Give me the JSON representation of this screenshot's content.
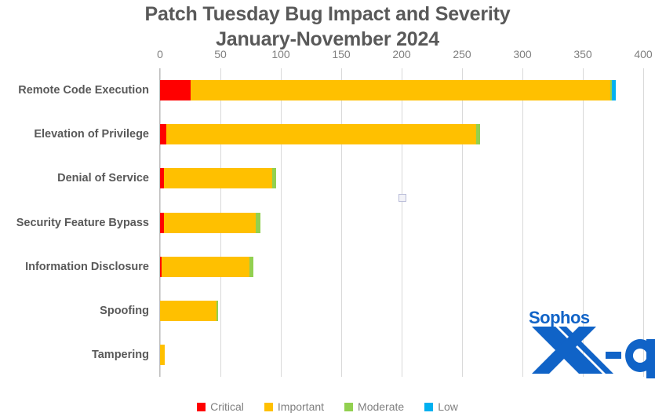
{
  "chart_data": {
    "type": "bar",
    "orientation": "horizontal",
    "stacked": true,
    "title": "Patch Tuesday Bug Impact and Severity",
    "subtitle": "January-November 2024",
    "xlabel": "",
    "ylabel": "",
    "xlim": [
      0,
      400
    ],
    "xticks": [
      0,
      50,
      100,
      150,
      200,
      250,
      300,
      350,
      400
    ],
    "grid": "vertical",
    "legend_position": "bottom",
    "categories": [
      "Remote Code Execution",
      "Elevation of Privilege",
      "Denial of Service",
      "Security Feature Bypass",
      "Information Disclosure",
      "Spoofing",
      "Tampering"
    ],
    "series": [
      {
        "name": "Critical",
        "color": "#FF0000",
        "values": [
          25,
          5,
          3,
          3,
          1,
          0,
          0
        ]
      },
      {
        "name": "Important",
        "color": "#FFC000",
        "values": [
          348,
          257,
          90,
          76,
          73,
          47,
          4
        ]
      },
      {
        "name": "Moderate",
        "color": "#92D050",
        "values": [
          1,
          3,
          3,
          4,
          3,
          1,
          0
        ]
      },
      {
        "name": "Low",
        "color": "#00B0F0",
        "values": [
          3,
          0,
          0,
          0,
          0,
          0,
          0
        ]
      }
    ],
    "totals": [
      377,
      265,
      96,
      83,
      77,
      48,
      4
    ]
  },
  "chart": {
    "title_line_1": "Patch Tuesday Bug Impact and Severity",
    "title_line_2": "January-November 2024",
    "xticks": [
      "0",
      "50",
      "100",
      "150",
      "200",
      "250",
      "300",
      "350",
      "400"
    ],
    "categories": [
      "Remote Code Execution",
      "Elevation of Privilege",
      "Denial of Service",
      "Security Feature Bypass",
      "Information Disclosure",
      "Spoofing",
      "Tampering"
    ],
    "legend": [
      {
        "label": "Critical",
        "color": "#FF0000"
      },
      {
        "label": "Important",
        "color": "#FFC000"
      },
      {
        "label": "Moderate",
        "color": "#92D050"
      },
      {
        "label": "Low",
        "color": "#00B0F0"
      }
    ]
  },
  "branding": {
    "word": "Sophos",
    "lockup": "X-Ops",
    "color": "#1063c7"
  }
}
